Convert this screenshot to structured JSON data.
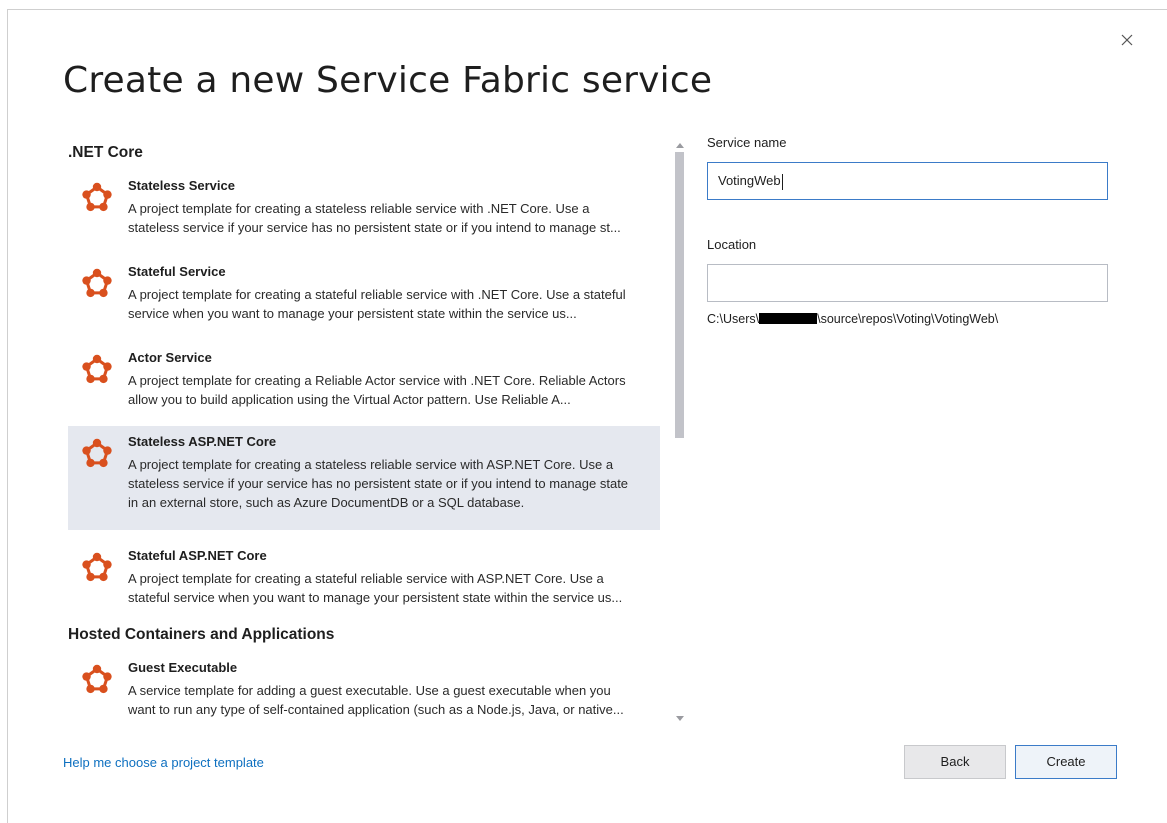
{
  "dialog": {
    "title": "Create a new Service Fabric service",
    "close_icon": "close-icon"
  },
  "templates": {
    "groups": [
      {
        "header": ".NET Core",
        "items": [
          {
            "name": "Stateless Service",
            "desc": "A project template for creating a stateless reliable service with .NET Core. Use a stateless service if your service has no persistent state or if you intend to manage st..."
          },
          {
            "name": "Stateful Service",
            "desc": "A project template for creating a stateful reliable service with .NET Core. Use a stateful service when you want to manage your persistent state within the service us..."
          },
          {
            "name": "Actor Service",
            "desc": "A project template for creating a Reliable Actor service with .NET Core. Reliable Actors allow you to build application using the Virtual Actor pattern. Use Reliable A..."
          },
          {
            "name": "Stateless ASP.NET Core",
            "desc": "A project template for creating a stateless reliable service with ASP.NET Core. Use a stateless service if your service has no persistent state or if you intend to manage state in an external store, such as Azure DocumentDB or a SQL database.",
            "selected": true
          },
          {
            "name": "Stateful ASP.NET Core",
            "desc": "A project template for creating a stateful reliable service with ASP.NET Core. Use a stateful service when you want to manage your persistent state within the service us..."
          }
        ]
      },
      {
        "header": "Hosted Containers and Applications",
        "items": [
          {
            "name": "Guest Executable",
            "desc": "A service template for adding a guest executable. Use a guest executable when you want to run any type of self-contained application (such as a Node.js, Java, or native..."
          }
        ]
      }
    ],
    "icon": "service-fabric-icon",
    "icon_color": "#d9501e"
  },
  "form": {
    "service_name_label": "Service name",
    "service_name_value": "VotingWeb",
    "location_label": "Location",
    "location_value": "",
    "path_prefix": "C:\\Users\\",
    "path_suffix": "\\source\\repos\\Voting\\VotingWeb\\"
  },
  "footer": {
    "help_link": "Help me choose a project template",
    "back_label": "Back",
    "create_label": "Create"
  },
  "colors": {
    "selected_bg": "#e5e8ef",
    "link": "#0e70c0",
    "focus_border": "#3b7bc8"
  }
}
